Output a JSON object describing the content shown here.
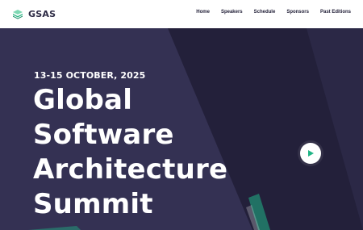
{
  "header": {
    "brand": "GSAS",
    "nav": [
      "Home",
      "Speakers",
      "Schedule",
      "Sponsors",
      "Past Editions"
    ]
  },
  "hero": {
    "date": "13-15 OCTOBER, 2025",
    "title_lines": [
      "Global",
      "Software",
      "Architecture",
      "Summit"
    ],
    "play_icon": "play-icon"
  },
  "colors": {
    "hero_bg": "#343153",
    "hero_bg_dark": "#23203a",
    "accent": "#20b486",
    "text_light": "#ffffff",
    "nav_text": "#24223a"
  }
}
